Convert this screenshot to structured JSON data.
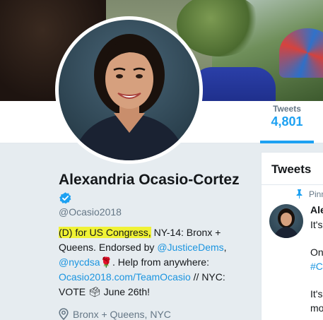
{
  "profile": {
    "name": "Alexandria Ocasio-Cortez",
    "handle": "@Ocasio2018",
    "bio": {
      "highlight": "(D) for US Congress,",
      "text1": " NY-14: Bronx + Queens. Endorsed by ",
      "link1": "@JusticeDems",
      "text2": ", ",
      "link2": "@nycdsa",
      "emoji_rose": "🌹",
      "text3": ". Help from anywhere: ",
      "link3": "Ocasio2018.com/TeamOcasio",
      "text4": " // NYC: VOTE ",
      "emoji_ballot": "🗳",
      "text5": " June 26th!"
    },
    "location": "Bronx + Queens, NYC"
  },
  "stats": {
    "tweets_label": "Tweets",
    "tweets_value": "4,801"
  },
  "tweets_panel": {
    "title": "Tweets",
    "pinned_label": "Pinn",
    "author": "Ale",
    "lines": [
      "It's",
      "On",
      "#Co",
      "It's",
      "mo"
    ]
  },
  "colors": {
    "accent": "#1da1f2",
    "link": "#1b95e0",
    "highlight": "#f0f235"
  },
  "icons": {
    "verified": "verified-badge-icon",
    "location": "map-pin-icon",
    "pinned": "pin-icon"
  }
}
